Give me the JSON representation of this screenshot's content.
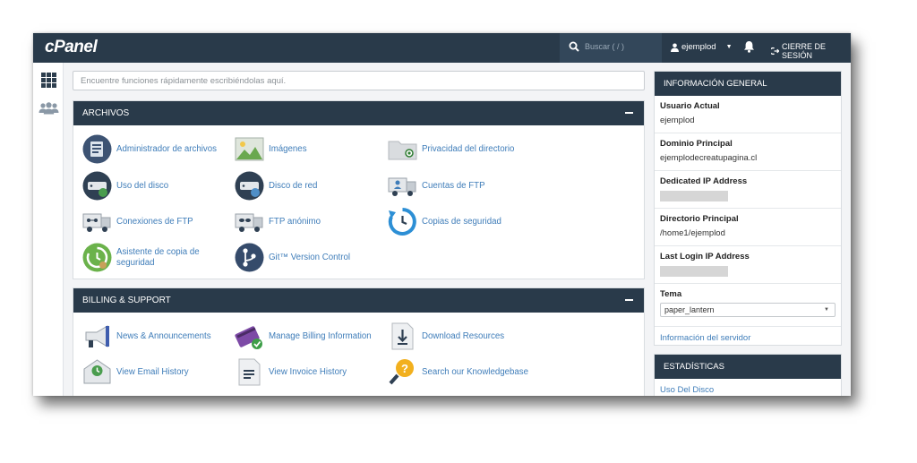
{
  "topbar": {
    "logo": "cPanel",
    "search_placeholder": "Buscar ( / )",
    "username": "ejemplod",
    "logout": "CIERRE DE SESIÓN"
  },
  "quick_search": {
    "placeholder": "Encuentre funciones rápidamente escribiéndolas aquí."
  },
  "archivos": {
    "title": "ARCHIVOS",
    "items": [
      {
        "label": "Administrador de archivos",
        "icon": "file-manager-icon"
      },
      {
        "label": "Imágenes",
        "icon": "images-icon"
      },
      {
        "label": "Privacidad del directorio",
        "icon": "directory-privacy-icon"
      },
      {
        "label": "Uso del disco",
        "icon": "disk-usage-icon"
      },
      {
        "label": "Disco de red",
        "icon": "web-disk-icon"
      },
      {
        "label": "Cuentas de FTP",
        "icon": "ftp-accounts-icon"
      },
      {
        "label": "Conexiones de FTP",
        "icon": "ftp-connections-icon"
      },
      {
        "label": "FTP anónimo",
        "icon": "anonymous-ftp-icon"
      },
      {
        "label": "Copias de seguridad",
        "icon": "backup-icon"
      },
      {
        "label": "Asistente de copia de seguridad",
        "icon": "backup-wizard-icon"
      },
      {
        "label": "Git™ Version Control",
        "icon": "git-icon"
      }
    ]
  },
  "billing": {
    "title": "BILLING & SUPPORT",
    "items": [
      {
        "label": "News & Announcements",
        "icon": "megaphone-icon"
      },
      {
        "label": "Manage Billing Information",
        "icon": "billing-card-icon"
      },
      {
        "label": "Download Resources",
        "icon": "download-icon"
      },
      {
        "label": "View Email History",
        "icon": "email-history-icon"
      },
      {
        "label": "View Invoice History",
        "icon": "invoice-icon"
      },
      {
        "label": "Search our Knowledgebase",
        "icon": "knowledgebase-icon"
      }
    ]
  },
  "general_info": {
    "title": "INFORMACIÓN GENERAL",
    "rows": [
      {
        "label": "Usuario Actual",
        "value": "ejemplod"
      },
      {
        "label": "Dominio Principal",
        "value": "ejemplodecreatupagina.cl"
      },
      {
        "label": "Dedicated IP Address",
        "value": ""
      },
      {
        "label": "Directorio Principal",
        "value": "/home1/ejemplod"
      },
      {
        "label": "Last Login IP Address",
        "value": ""
      }
    ],
    "theme_label": "Tema",
    "theme_value": "paper_lantern",
    "server_info_link": "Información del servidor"
  },
  "stats": {
    "title": "ESTADÍSTICAS",
    "first_item": "Uso Del Disco"
  },
  "colors": {
    "header": "#293a4a",
    "link": "#3f7db9"
  }
}
